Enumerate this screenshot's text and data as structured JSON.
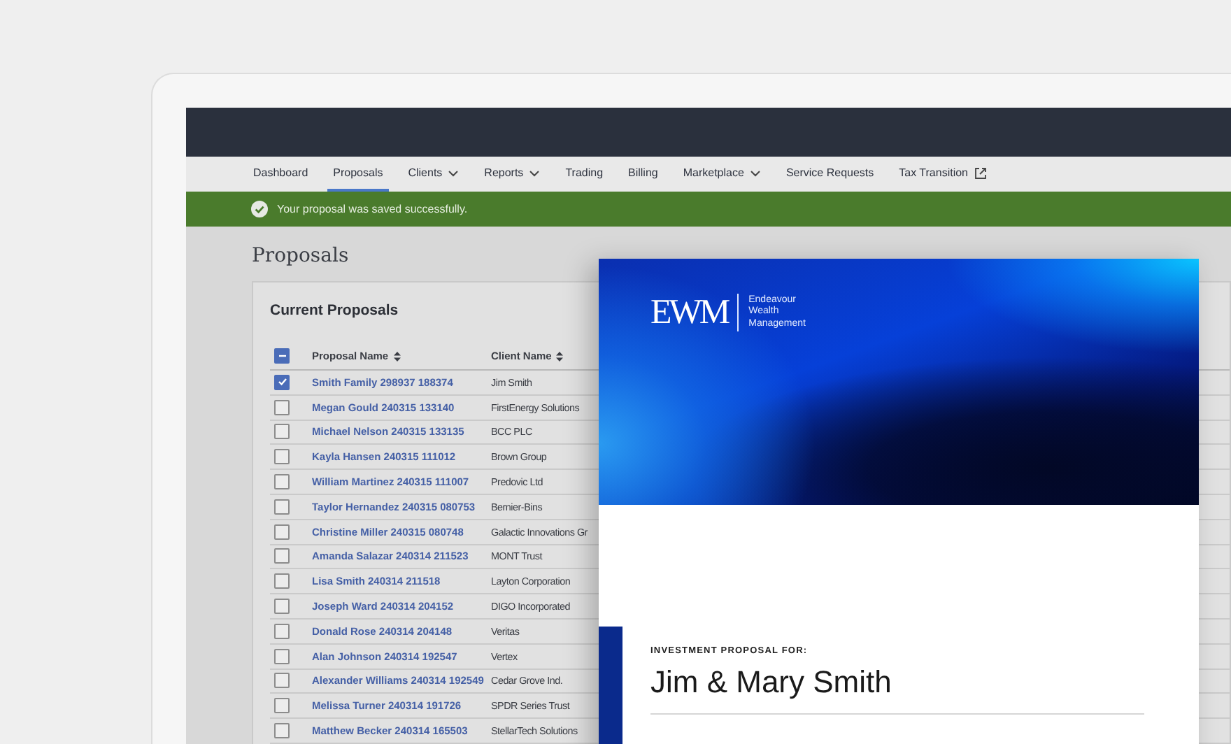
{
  "nav": [
    {
      "label": "Dashboard",
      "selected": false,
      "kind": "plain"
    },
    {
      "label": "Proposals",
      "selected": true,
      "kind": "plain"
    },
    {
      "label": "Clients",
      "selected": false,
      "kind": "dropdown"
    },
    {
      "label": "Reports",
      "selected": false,
      "kind": "dropdown"
    },
    {
      "label": "Trading",
      "selected": false,
      "kind": "plain"
    },
    {
      "label": "Billing",
      "selected": false,
      "kind": "plain"
    },
    {
      "label": "Marketplace",
      "selected": false,
      "kind": "dropdown"
    },
    {
      "label": "Service Requests",
      "selected": false,
      "kind": "plain"
    },
    {
      "label": "Tax Transition",
      "selected": false,
      "kind": "external"
    }
  ],
  "alert": {
    "message": "Your proposal was saved successfully."
  },
  "page_title": "Proposals",
  "table": {
    "title": "Current Proposals",
    "select_all": {
      "indeterminate": true
    },
    "columns": [
      "Proposal Name",
      "Client Name"
    ],
    "rows": [
      {
        "name": "Smith Family 298937 188374",
        "client": "Jim Smith",
        "checked": true
      },
      {
        "name": "Megan Gould 240315 133140",
        "client": "FirstEnergy Solutions",
        "checked": false
      },
      {
        "name": "Michael Nelson 240315 133135",
        "client": "BCC PLC",
        "checked": false
      },
      {
        "name": "Kayla Hansen 240315 111012",
        "client": "Brown Group",
        "checked": false
      },
      {
        "name": "William Martinez 240315 111007",
        "client": "Predovic Ltd",
        "checked": false
      },
      {
        "name": "Taylor Hernandez 240315 080753",
        "client": "Bernier-Bins",
        "checked": false
      },
      {
        "name": "Christine Miller 240315 080748",
        "client": "Galactic Innovations Gr",
        "checked": false
      },
      {
        "name": "Amanda Salazar 240314 211523",
        "client": "MONT Trust",
        "checked": false
      },
      {
        "name": "Lisa Smith 240314 211518",
        "client": "Layton Corporation",
        "checked": false
      },
      {
        "name": "Joseph Ward 240314 204152",
        "client": "DIGO Incorporated",
        "checked": false
      },
      {
        "name": "Donald Rose 240314 204148",
        "client": "Veritas",
        "checked": false
      },
      {
        "name": "Alan Johnson 240314 192547",
        "client": "Vertex",
        "checked": false
      },
      {
        "name": "Alexander Williams 240314 192549",
        "client": "Cedar Grove Ind.",
        "checked": false
      },
      {
        "name": "Melissa Turner 240314 191726",
        "client": "SPDR Series Trust",
        "checked": false
      },
      {
        "name": "Matthew Becker 240314 165503",
        "client": "StellarTech Solutions",
        "checked": false
      }
    ]
  },
  "document": {
    "logo": {
      "mark": "EWM",
      "lines": [
        "Endeavour",
        "Wealth",
        "Management"
      ]
    },
    "eyebrow": "INVESTMENT PROPOSAL FOR:",
    "client": "Jim & Mary Smith"
  }
}
